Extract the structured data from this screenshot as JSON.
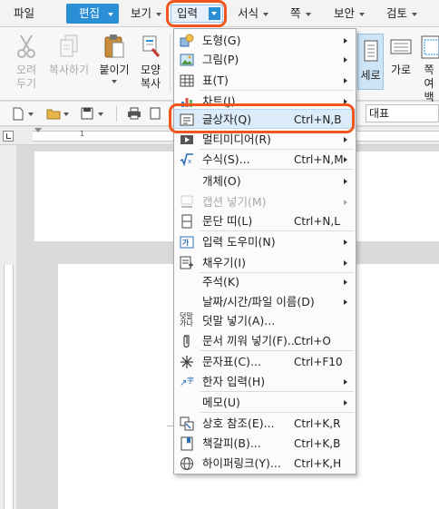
{
  "menubar": {
    "file": "파일",
    "edit": "편집",
    "view": "보기",
    "insert": "입력",
    "format": "서식",
    "page": "쪽",
    "security": "보안",
    "review": "검토"
  },
  "ribbon": {
    "cut": "오려\n두기",
    "copy": "복사하기",
    "paste": "붙이기",
    "format_copy": "모양\n복사",
    "portrait": "세로",
    "landscape": "가로",
    "next_partial": "쪽\n여백"
  },
  "toolbar2": {
    "style_value": "대표"
  },
  "ruler": {
    "mark_1": "1"
  },
  "insert_menu": {
    "items": [
      {
        "label": "도형(G)",
        "shortcut": "",
        "submenu": true,
        "disabled": false,
        "icon": "shape-icon"
      },
      {
        "label": "그림(P)",
        "shortcut": "",
        "submenu": true,
        "disabled": false,
        "icon": "picture-icon"
      },
      {
        "label": "표(T)",
        "shortcut": "",
        "submenu": true,
        "disabled": false,
        "icon": "table-icon"
      },
      {
        "label": "차트(J)",
        "shortcut": "",
        "submenu": true,
        "disabled": false,
        "icon": "chart-icon"
      },
      {
        "label": "글상자(Q)",
        "shortcut": "Ctrl+N,B",
        "submenu": false,
        "disabled": false,
        "icon": "textbox-icon"
      },
      {
        "label": "멀티미디어(R)",
        "shortcut": "",
        "submenu": true,
        "disabled": false,
        "icon": "multimedia-icon"
      },
      {
        "label": "수식(S)...",
        "shortcut": "Ctrl+N,M",
        "submenu": true,
        "disabled": false,
        "icon": "formula-icon"
      },
      {
        "label": "개체(O)",
        "shortcut": "",
        "submenu": true,
        "disabled": false,
        "icon": ""
      },
      {
        "label": "캡션 넣기(M)",
        "shortcut": "",
        "submenu": true,
        "disabled": true,
        "icon": "caption-icon"
      },
      {
        "label": "문단 띠(L)",
        "shortcut": "Ctrl+N,L",
        "submenu": false,
        "disabled": false,
        "icon": "paragraph-band-icon"
      },
      {
        "label": "입력 도우미(N)",
        "shortcut": "",
        "submenu": true,
        "disabled": false,
        "icon": "input-helper-icon"
      },
      {
        "label": "채우기(I)",
        "shortcut": "",
        "submenu": true,
        "disabled": false,
        "icon": "fill-icon"
      },
      {
        "label": "주석(K)",
        "shortcut": "",
        "submenu": true,
        "disabled": false,
        "icon": ""
      },
      {
        "label": "날짜/시간/파일 이름(D)",
        "shortcut": "",
        "submenu": true,
        "disabled": false,
        "icon": ""
      },
      {
        "label": "덧말 넣기(A)...",
        "shortcut": "",
        "submenu": false,
        "disabled": false,
        "icon": "ruby-text-icon",
        "icon_text": "덧말\n가나"
      },
      {
        "label": "문서 끼워 넣기(F)...",
        "shortcut": "Ctrl+O",
        "submenu": false,
        "disabled": false,
        "icon": "insert-document-icon"
      },
      {
        "label": "문자표(C)...",
        "shortcut": "Ctrl+F10",
        "submenu": false,
        "disabled": false,
        "icon": "character-map-icon"
      },
      {
        "label": "한자 입력(H)",
        "shortcut": "",
        "submenu": true,
        "disabled": false,
        "icon": "hanja-icon"
      },
      {
        "label": "메모(U)",
        "shortcut": "",
        "submenu": true,
        "disabled": false,
        "icon": ""
      },
      {
        "label": "상호 참조(E)...",
        "shortcut": "Ctrl+K,R",
        "submenu": false,
        "disabled": false,
        "icon": "cross-reference-icon"
      },
      {
        "label": "책갈피(B)...",
        "shortcut": "Ctrl+K,B",
        "submenu": false,
        "disabled": false,
        "icon": "bookmark-icon"
      },
      {
        "label": "하이퍼링크(Y)...",
        "shortcut": "Ctrl+K,H",
        "submenu": false,
        "disabled": false,
        "icon": "hyperlink-icon"
      }
    ]
  },
  "colors": {
    "accent_blue": "#2b8fd6",
    "highlight_orange": "#f0551e",
    "menu_hover": "#dcebf9"
  }
}
